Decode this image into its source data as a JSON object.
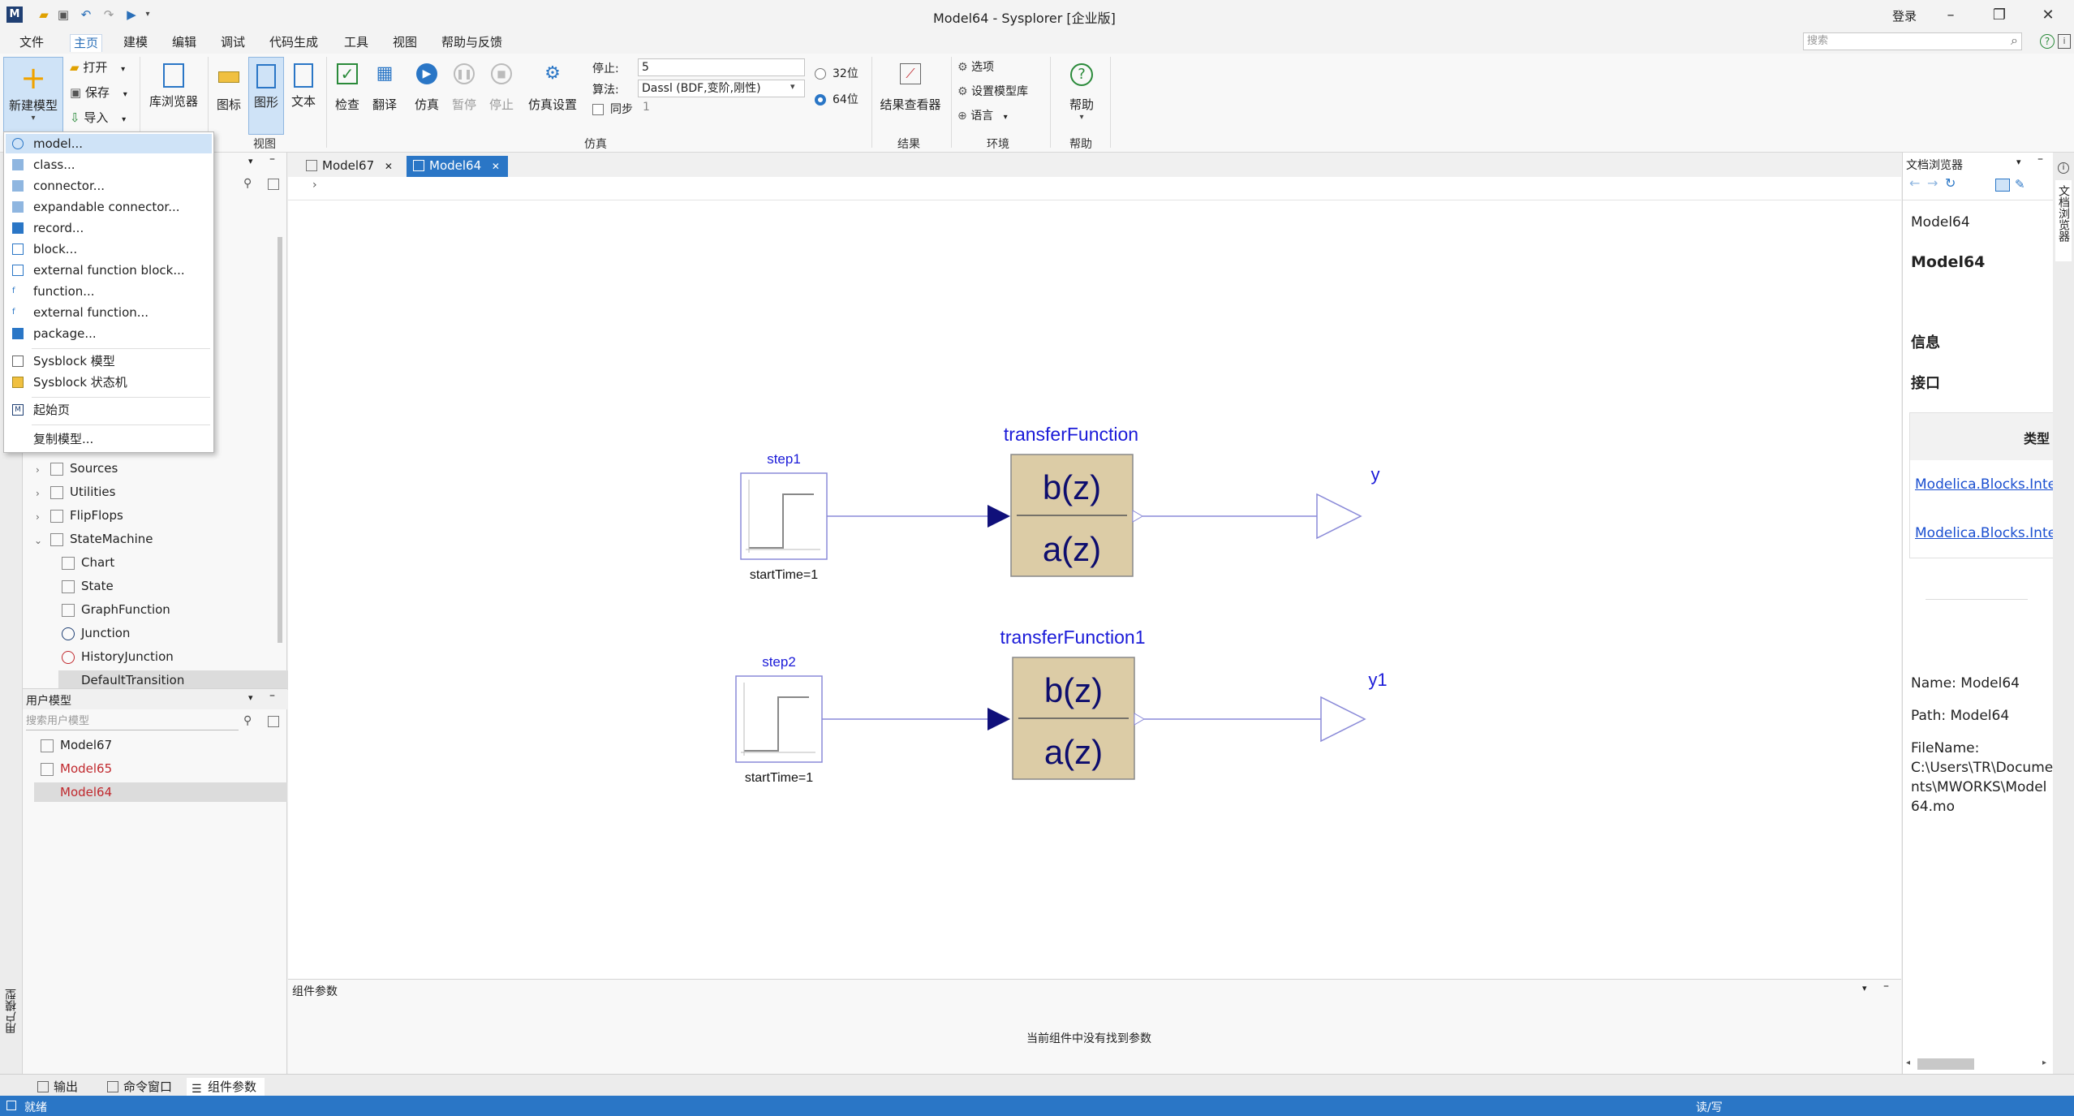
{
  "window": {
    "title": "Model64 - Sysplorer [企业版]",
    "login": "登录",
    "minimize": "–",
    "maximize": "❐",
    "close": "✕"
  },
  "menubar": {
    "items": [
      "文件",
      "主页",
      "建模",
      "编辑",
      "调试",
      "代码生成",
      "工具",
      "视图",
      "帮助与反馈"
    ],
    "active": "主页",
    "search_placeholder": "搜索"
  },
  "ribbon": {
    "new_model": "新建模型",
    "open": "打开",
    "save": "保存",
    "import": "导入",
    "lib_browser": "库浏览器",
    "icon": "图标",
    "diagram": "图形",
    "text": "文本",
    "view_group": "视图",
    "check": "检查",
    "translate": "翻译",
    "simulate": "仿真",
    "pause": "暂停",
    "stop": "停止",
    "sim_settings": "仿真设置",
    "stop_label": "停止:",
    "stop_value": "5",
    "algo_label": "算法:",
    "algo_value": "Dassl (BDF,变阶,刚性)",
    "sync_label": "同步",
    "sync_value": "1",
    "bit32": "32位",
    "bit64": "64位",
    "sim_group": "仿真",
    "result_viewer": "结果查看器",
    "result_group": "结果",
    "options": "选项",
    "set_lib": "设置模型库",
    "language": "语言",
    "env_group": "环境",
    "help": "帮助",
    "help_group": "帮助"
  },
  "new_menu": {
    "items": [
      "model...",
      "class...",
      "connector...",
      "expandable connector...",
      "record...",
      "block...",
      "external function block...",
      "function...",
      "external function...",
      "package..."
    ],
    "sysblock_model": "Sysblock 模型",
    "sysblock_state": "Sysblock 状态机",
    "start_page": "起始页",
    "copy_model": "复制模型..."
  },
  "lib_tree": {
    "items": [
      "Sources",
      "Utilities",
      "FlipFlops",
      "StateMachine"
    ],
    "children": [
      "Chart",
      "State",
      "GraphFunction",
      "Junction",
      "HistoryJunction",
      "DefaultTransition"
    ]
  },
  "user_models": {
    "header": "用户模型",
    "search_placeholder": "搜索用户模型",
    "items": [
      {
        "name": "Model67",
        "color": "#222222"
      },
      {
        "name": "Model65",
        "color": "#c0282d"
      },
      {
        "name": "Model64",
        "color": "#c0282d"
      }
    ]
  },
  "left_vertical_tab": "用户模型",
  "tabs": [
    {
      "label": "Model67",
      "active": false
    },
    {
      "label": "Model64",
      "active": true
    }
  ],
  "diagram": {
    "step1": "step1",
    "step1_param": "startTime=1",
    "step2": "step2",
    "step2_param": "startTime=1",
    "tf1": "transferFunction",
    "tf2": "transferFunction1",
    "num": "b(z)",
    "den": "a(z)",
    "out1": "y",
    "out2": "y1"
  },
  "doc_browser": {
    "header": "文档浏览器",
    "crumb": "Model64",
    "title": "Model64",
    "info": "信息",
    "interface": "接口",
    "type_col": "类型",
    "link1": "Modelica.Blocks.Inter",
    "link2": "Modelica.Blocks.Inter",
    "name_line": "Name: Model64",
    "path_line": "Path: Model64",
    "filename_label": "FileName:",
    "filename_lines": [
      "C:\\Users\\TR\\Docume",
      "nts\\MWORKS\\Model",
      "64.mo"
    ],
    "vertical_tab": "文档浏览器"
  },
  "params": {
    "header": "组件参数",
    "empty": "当前组件中没有找到参数"
  },
  "bottom_tabs": [
    "输出",
    "命令窗口",
    "组件参数"
  ],
  "status": {
    "left": "就绪",
    "right": "读/写"
  }
}
